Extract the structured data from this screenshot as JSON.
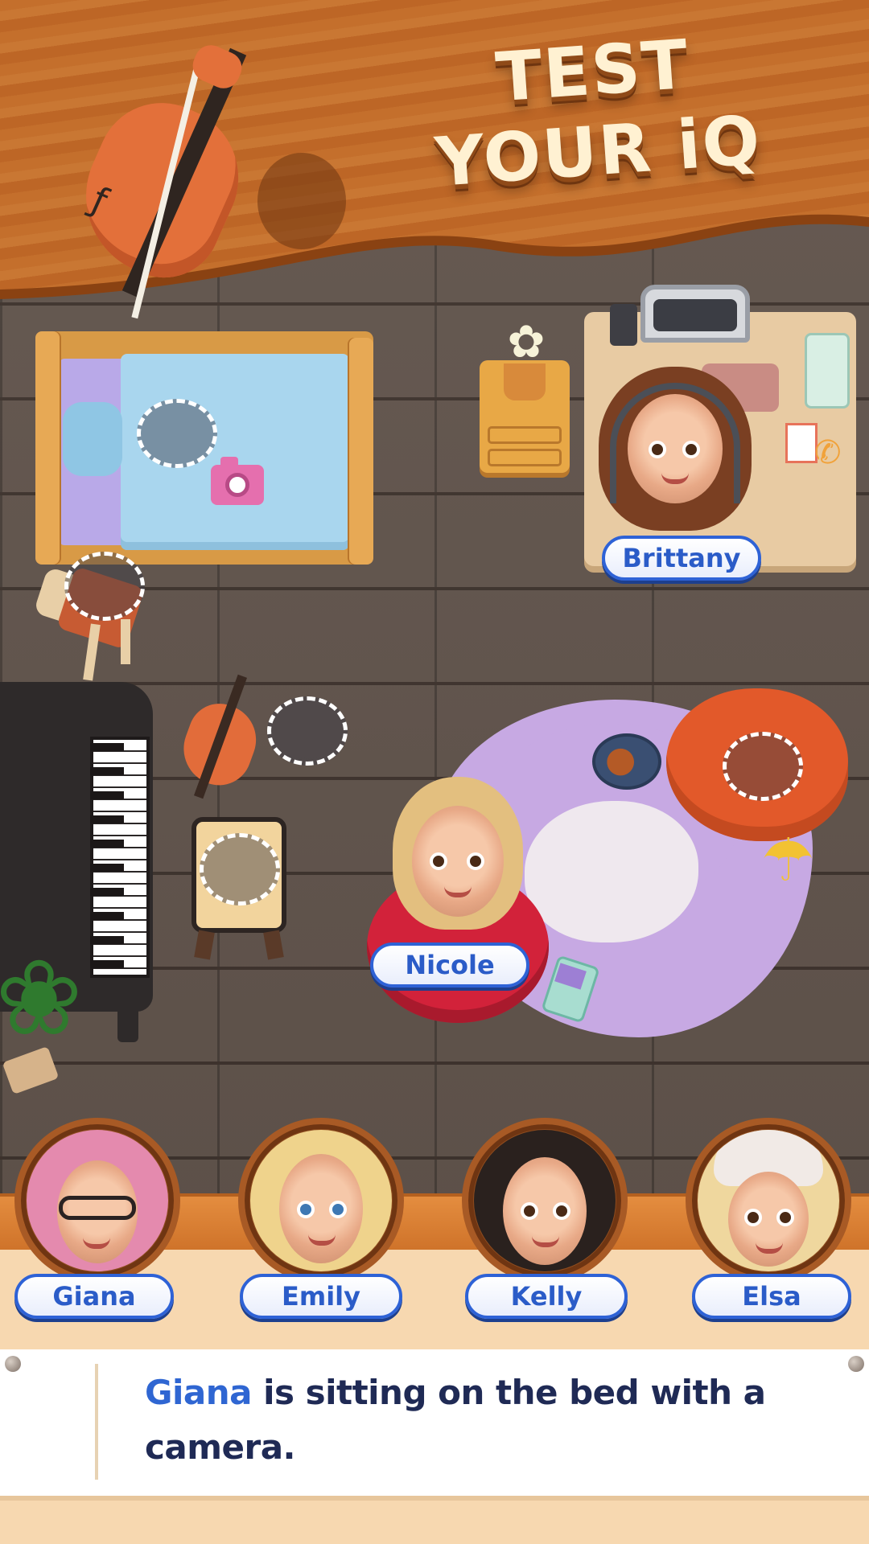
{
  "header": {
    "title_line1": "TEST",
    "title_line2": "YOUR iQ"
  },
  "board": {
    "placed_characters": [
      {
        "name": "Brittany"
      },
      {
        "name": "Nicole"
      }
    ]
  },
  "roster": [
    {
      "name": "Giana"
    },
    {
      "name": "Emily"
    },
    {
      "name": "Kelly"
    },
    {
      "name": "Elsa"
    }
  ],
  "clue": {
    "subject": "Giana",
    "text": " is sitting on the bed with a camera."
  },
  "colors": {
    "label_border": "#2e62d6",
    "label_text": "#2b5cc8",
    "clue_highlight": "#2f66d2",
    "clue_text": "#1f2a55",
    "banner_wood": "#c46f2c",
    "title_cream": "#fff1d2"
  }
}
